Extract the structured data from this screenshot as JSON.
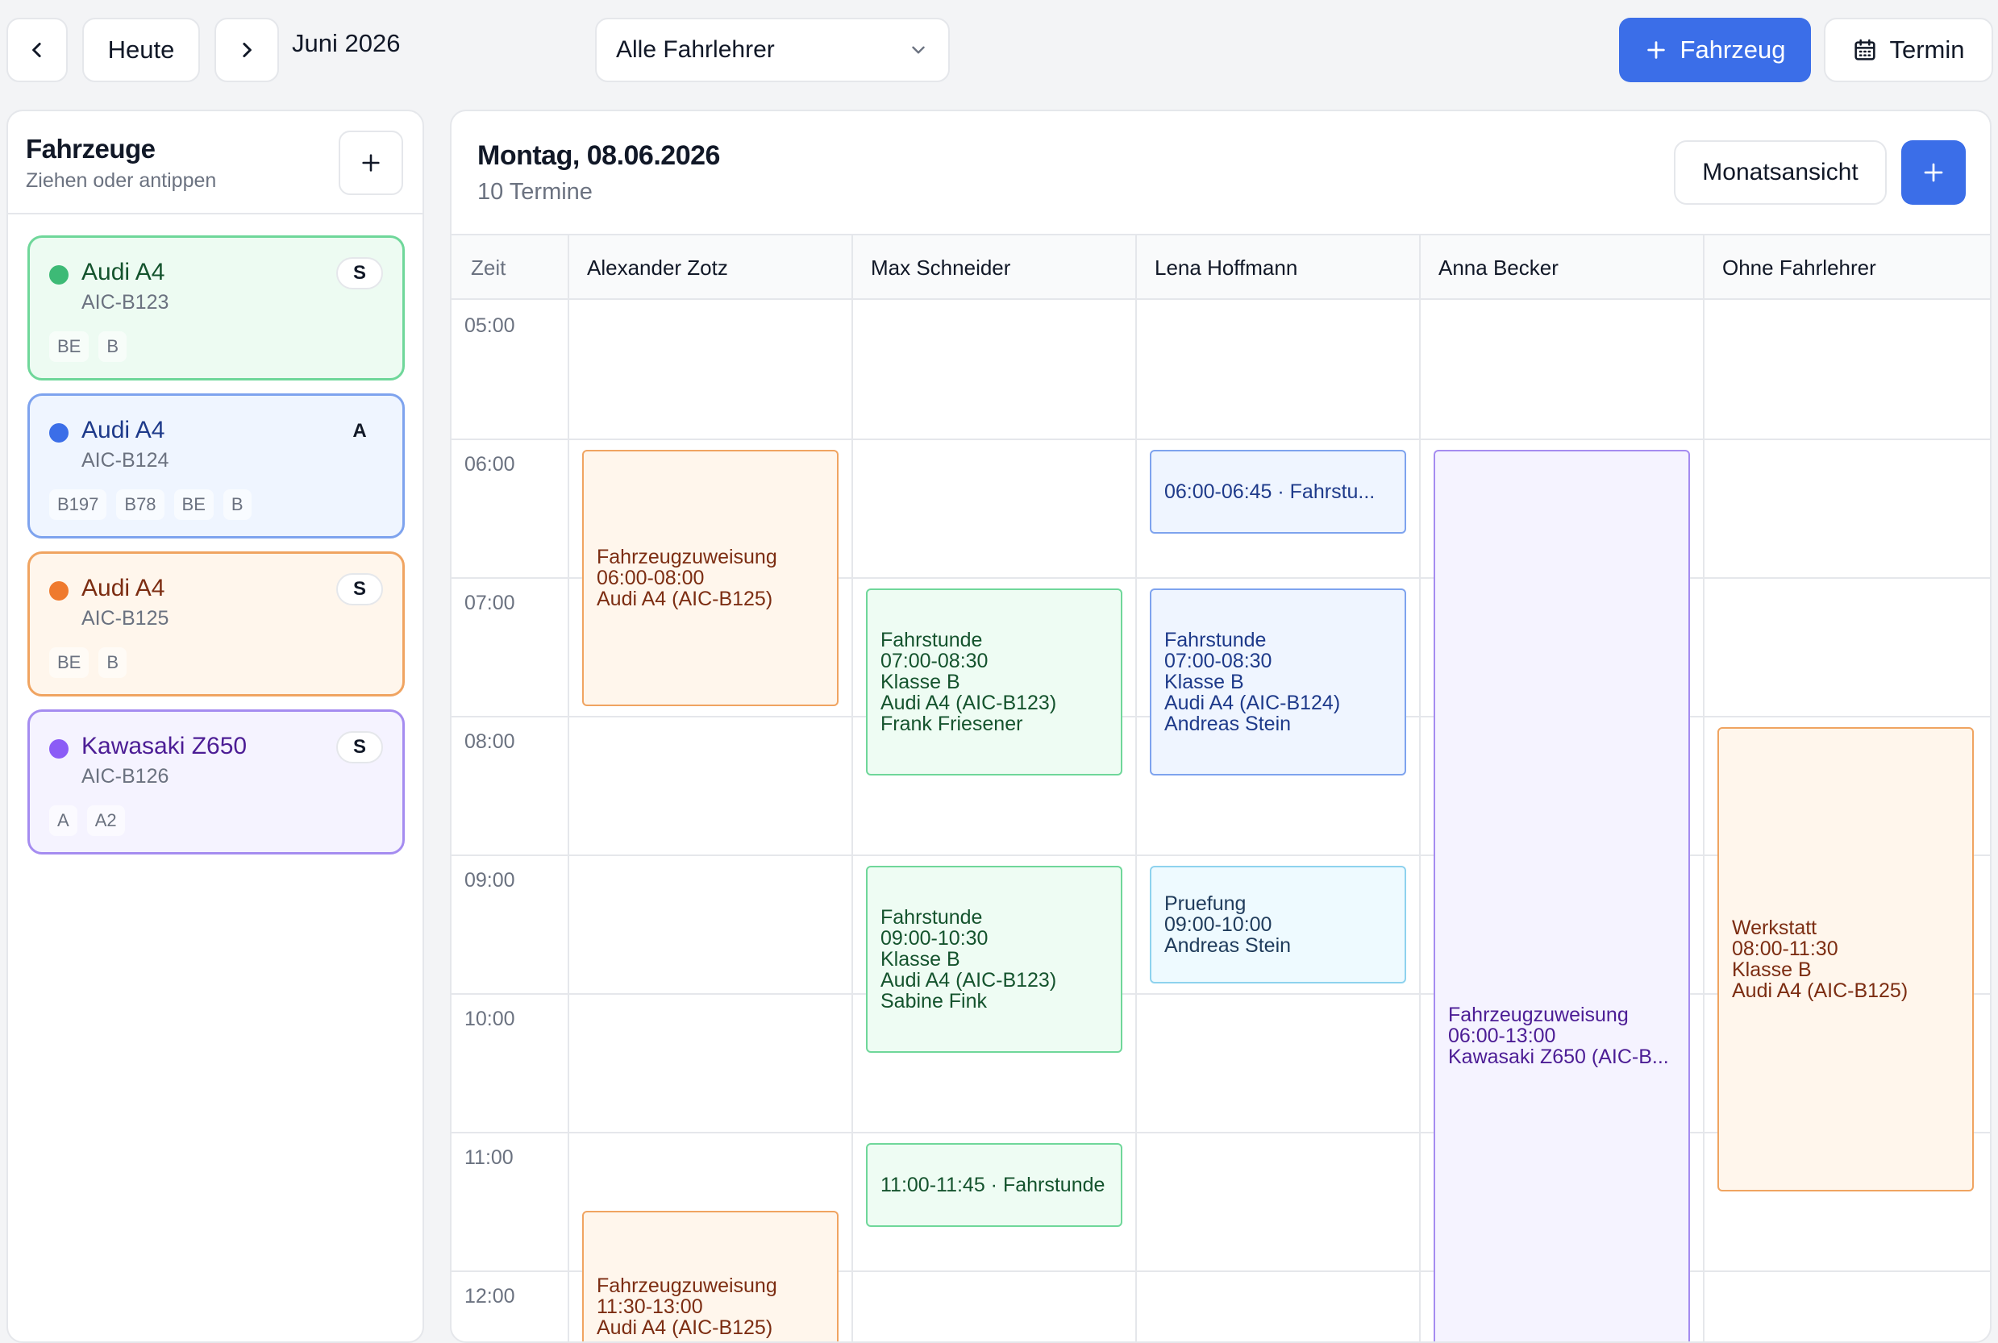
{
  "topbar": {
    "today_label": "Heute",
    "month_label": "Juni 2026",
    "instructor_filter": "Alle Fahrlehrer",
    "add_vehicle_label": "Fahrzeug",
    "appointment_label": "Termin"
  },
  "sidebar": {
    "title": "Fahrzeuge",
    "subtitle": "Ziehen oder antippen",
    "vehicles": [
      {
        "name": "Audi A4",
        "plate": "AIC-B123",
        "badge": "S",
        "tags": [
          "BE",
          "B"
        ],
        "color": "#3dba76"
      },
      {
        "name": "Audi A4",
        "plate": "AIC-B124",
        "badge": "A",
        "tags": [
          "B197",
          "B78",
          "BE",
          "B"
        ],
        "color": "#3b6ee8"
      },
      {
        "name": "Audi A4",
        "plate": "AIC-B125",
        "badge": "S",
        "tags": [
          "BE",
          "B"
        ],
        "color": "#ef7a2e"
      },
      {
        "name": "Kawasaki Z650",
        "plate": "AIC-B126",
        "badge": "S",
        "tags": [
          "A",
          "A2"
        ],
        "color": "#8b5cf6"
      }
    ]
  },
  "calendar": {
    "date_title": "Montag, 08.06.2026",
    "count_label": "10 Termine",
    "month_view_label": "Monatsansicht",
    "columns": [
      "Zeit",
      "Alexander Zotz",
      "Max Schneider",
      "Lena Hoffmann",
      "Anna Becker",
      "Ohne Fahrlehrer"
    ],
    "hours": [
      "05:00",
      "06:00",
      "07:00",
      "08:00",
      "09:00",
      "10:00",
      "11:00",
      "12:00"
    ],
    "events": [
      {
        "lines": [
          "Fahrzeugzuweisung",
          "06:00-08:00",
          "Audi A4 (AIC-B125)"
        ]
      },
      {
        "lines": [
          "Fahrzeugzuweisung",
          "11:30-13:00",
          "Audi A4 (AIC-B125)"
        ]
      },
      {
        "lines": [
          "Fahrstunde",
          "07:00-08:30",
          "Klasse B",
          "Audi A4 (AIC-B123)",
          "Frank Friesener"
        ]
      },
      {
        "lines": [
          "Fahrstunde",
          "09:00-10:30",
          "Klasse B",
          "Audi A4 (AIC-B123)",
          "Sabine Fink"
        ]
      },
      {
        "lines": [
          "11:00-11:45 · Fahrstunde"
        ]
      },
      {
        "lines": [
          "06:00-06:45 · Fahrstu..."
        ]
      },
      {
        "lines": [
          "Fahrstunde",
          "07:00-08:30",
          "Klasse B",
          "Audi A4 (AIC-B124)",
          "Andreas Stein"
        ]
      },
      {
        "lines": [
          "Pruefung",
          "09:00-10:00",
          "Andreas Stein"
        ]
      },
      {
        "lines": [
          "Fahrzeugzuweisung",
          "06:00-13:00",
          "Kawasaki Z650 (AIC-B..."
        ]
      },
      {
        "lines": [
          "Werkstatt",
          "08:00-11:30",
          "Klasse B",
          "Audi A4 (AIC-B125)"
        ]
      }
    ]
  }
}
